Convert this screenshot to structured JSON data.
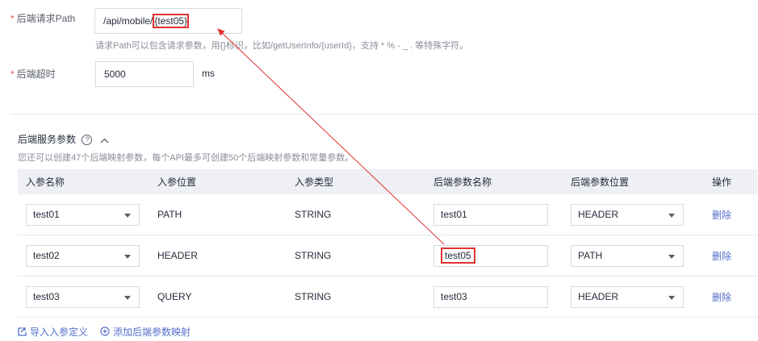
{
  "backend_path": {
    "label": "后端请求Path",
    "value_prefix": "/api/mobile/",
    "value_highlight": "{test05}",
    "hint": "请求Path可以包含请求参数，用{}标识，比如/getUserInfo/{userId}，支持 * % - _ . 等特殊字符。"
  },
  "backend_timeout": {
    "label": "后端超时",
    "value": "5000",
    "unit": "ms"
  },
  "service_params": {
    "title": "后端服务参数",
    "help_glyph": "?",
    "collapse_glyph": "^",
    "subtitle": "您还可以创建47个后端映射参数，每个API最多可创建50个后端映射参数和常量参数。",
    "columns": [
      "入参名称",
      "入参位置",
      "入参类型",
      "后端参数名称",
      "后端参数位置",
      "操作"
    ],
    "rows": [
      {
        "name": "test01",
        "location": "PATH",
        "type": "STRING",
        "backend_name": "test01",
        "backend_location": "HEADER",
        "action": "删除"
      },
      {
        "name": "test02",
        "location": "HEADER",
        "type": "STRING",
        "backend_name": "test05",
        "backend_location": "PATH",
        "action": "删除"
      },
      {
        "name": "test03",
        "location": "QUERY",
        "type": "STRING",
        "backend_name": "test03",
        "backend_location": "HEADER",
        "action": "删除"
      }
    ],
    "import_label": "导入入参定义",
    "add_label": "添加后端参数映射"
  },
  "colors": {
    "required": "#e84d4d",
    "link": "#526ecc",
    "highlight": "#e03131",
    "header_bg": "#eef0f5"
  },
  "icons": {
    "import": "import-icon",
    "add": "plus-circle-icon",
    "help": "question-circle-icon",
    "collapse": "chevron-up-icon",
    "dropdown": "chevron-down-icon"
  }
}
